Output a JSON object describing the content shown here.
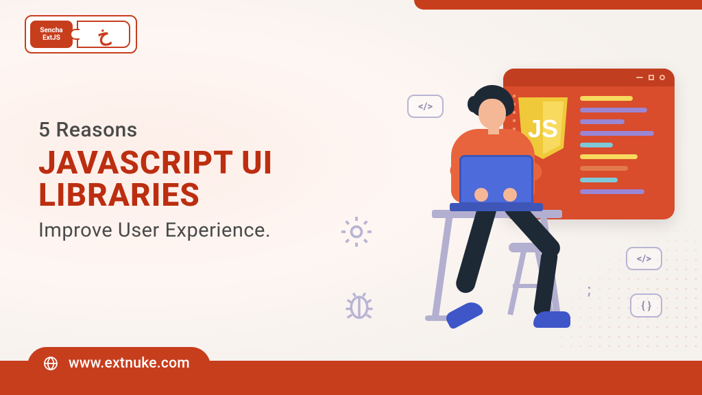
{
  "logo": {
    "brand": "Sencha",
    "product": "ExtJS"
  },
  "headline": {
    "eyebrow": "5 Reasons",
    "main_line1": "JAVASCRIPT UI",
    "main_line2": "LIBRARIES",
    "sub": "Improve User Experience."
  },
  "screen": {
    "badge": "JS"
  },
  "bubbles": {
    "code1": "</>",
    "code2": "</>",
    "braces": "{ }",
    "semicolon": ";"
  },
  "footer": {
    "url": "www.extnuke.com"
  },
  "colors": {
    "accent": "#c73e1d",
    "illustration_orange": "#d94c2c",
    "laptop_blue": "#4e6bdc",
    "outline_purple": "#b8b4d4"
  }
}
